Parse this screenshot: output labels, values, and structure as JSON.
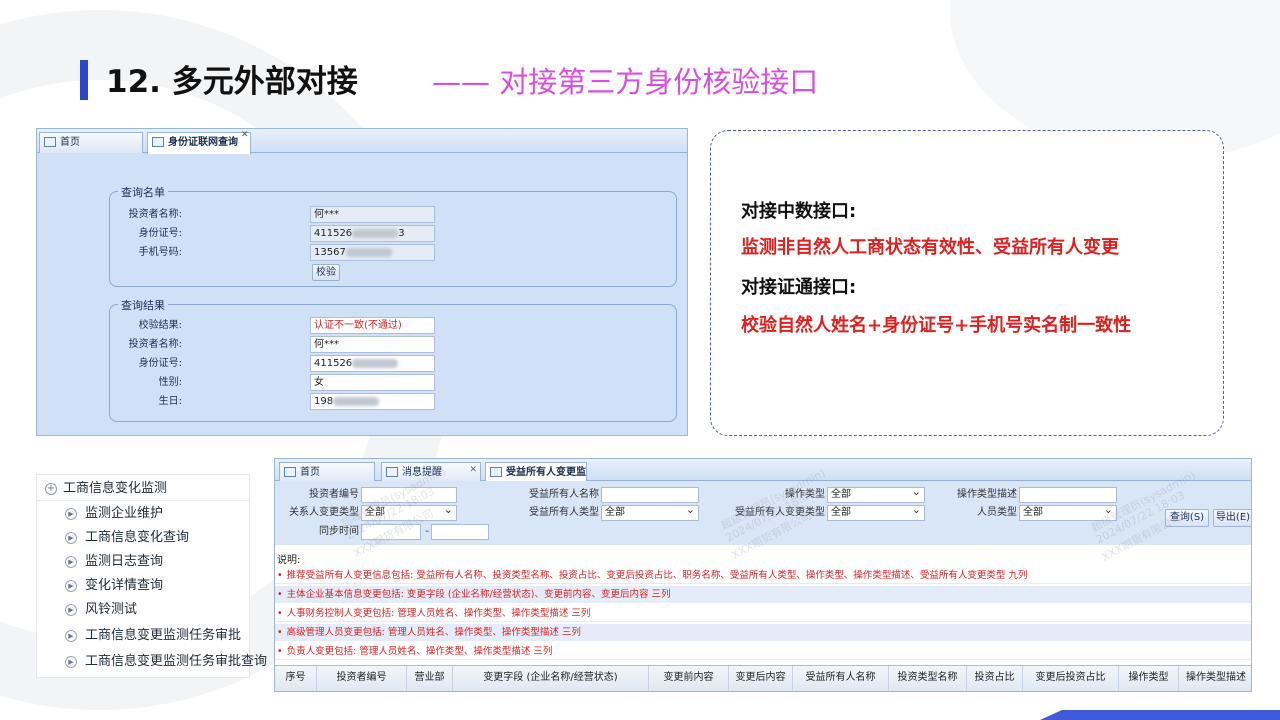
{
  "slide": {
    "title": "12. 多元外部对接",
    "subtitle": "—— 对接第三方身份核验接口"
  },
  "query_panel": {
    "tabs": [
      {
        "label": "首页",
        "icon": "home-icon"
      },
      {
        "label": "身份证联网查询",
        "icon": "page-icon"
      }
    ],
    "query_list": {
      "legend": "查询名单",
      "fields": [
        {
          "label": "投资者名称:",
          "value": "何***"
        },
        {
          "label": "身份证号:",
          "value_prefix": "411526",
          "value_suffix": "3"
        },
        {
          "label": "手机号码:",
          "value_prefix": "13567",
          "value_suffix": ""
        }
      ],
      "verify_button": "校验"
    },
    "query_result": {
      "legend": "查询结果",
      "fields": [
        {
          "label": "校验结果:",
          "value": "认证不一致(不通过)",
          "color": "#e02020"
        },
        {
          "label": "投资者名称:",
          "value": "何***"
        },
        {
          "label": "身份证号:",
          "value_prefix": "411526",
          "value_suffix": ""
        },
        {
          "label": "性别:",
          "value": "女"
        },
        {
          "label": "生日:",
          "value_prefix": "198",
          "value_suffix": ""
        }
      ]
    }
  },
  "info_box": {
    "line1": "对接中数接口:",
    "line2": "监测非自然人工商状态有效性、受益所有人变更",
    "line3": "对接证通接口:",
    "line4": "校验自然人姓名+身份证号+手机号实名制一致性",
    "accent_color": "#e0201e"
  },
  "tree": {
    "root": "工商信息变化监测",
    "items": [
      "监测企业维护",
      "工商信息变化查询",
      "监测日志查询",
      "变化详情查询",
      "风铃测试",
      "工商信息变更监测任务审批",
      "工商信息变更监测任务审批查询"
    ]
  },
  "beneficiary_panel": {
    "tabs": [
      {
        "label": "首页"
      },
      {
        "label": "消息提醒"
      },
      {
        "label": "受益所有人变更监"
      }
    ],
    "filters": {
      "investor_code": {
        "label": "投资者编号",
        "value": ""
      },
      "relation_type": {
        "label": "关系人变更类型",
        "value": "全部"
      },
      "sync_time": {
        "label": "同步时间",
        "value": "",
        "sep": "-"
      },
      "beneficiary_name": {
        "label": "受益所有人名称",
        "value": ""
      },
      "beneficiary_type": {
        "label": "受益所有人类型",
        "value": "全部"
      },
      "operation_type": {
        "label": "操作类型",
        "value": "全部"
      },
      "beneficiary_change_type": {
        "label": "受益所有人变更类型",
        "value": "全部"
      },
      "operation_desc": {
        "label": "操作类型描述",
        "value": ""
      },
      "person_type": {
        "label": "人员类型",
        "value": "全部"
      }
    },
    "buttons": {
      "query": "查询(S)",
      "export": "导出(E)"
    },
    "notes_title": "说明:",
    "notes": [
      "推荐受益所有人变更信息包括: 受益所有人名称、投资类型名称、投资占比、变更后投资占比、职务名称、受益所有人类型、操作类型、操作类型描述、受益所有人变更类型 九列",
      "主体企业基本信息变更包括: 变更字段 (企业名称/经营状态)、变更前内容、变更后内容 三列",
      "人事财务控制人变更包括: 管理人员姓名、操作类型、操作类型描述 三列",
      "高级管理人员变更包括: 管理人员姓名、操作类型、操作类型描述 三列",
      "负责人变更包括: 管理人员姓名、操作类型、操作类型描述 三列"
    ],
    "columns": [
      "序号",
      "投资者编号",
      "营业部",
      "变更字段 (企业名称/经营状态)",
      "变更前内容",
      "变更后内容",
      "受益所有人名称",
      "投资类型名称",
      "投资占比",
      "变更后投资占比",
      "操作类型",
      "操作类型描述"
    ]
  },
  "watermarks": [
    "超级管理员(sysadmin)",
    "2024/07/22 18:03",
    "XXX期货有限公司"
  ]
}
